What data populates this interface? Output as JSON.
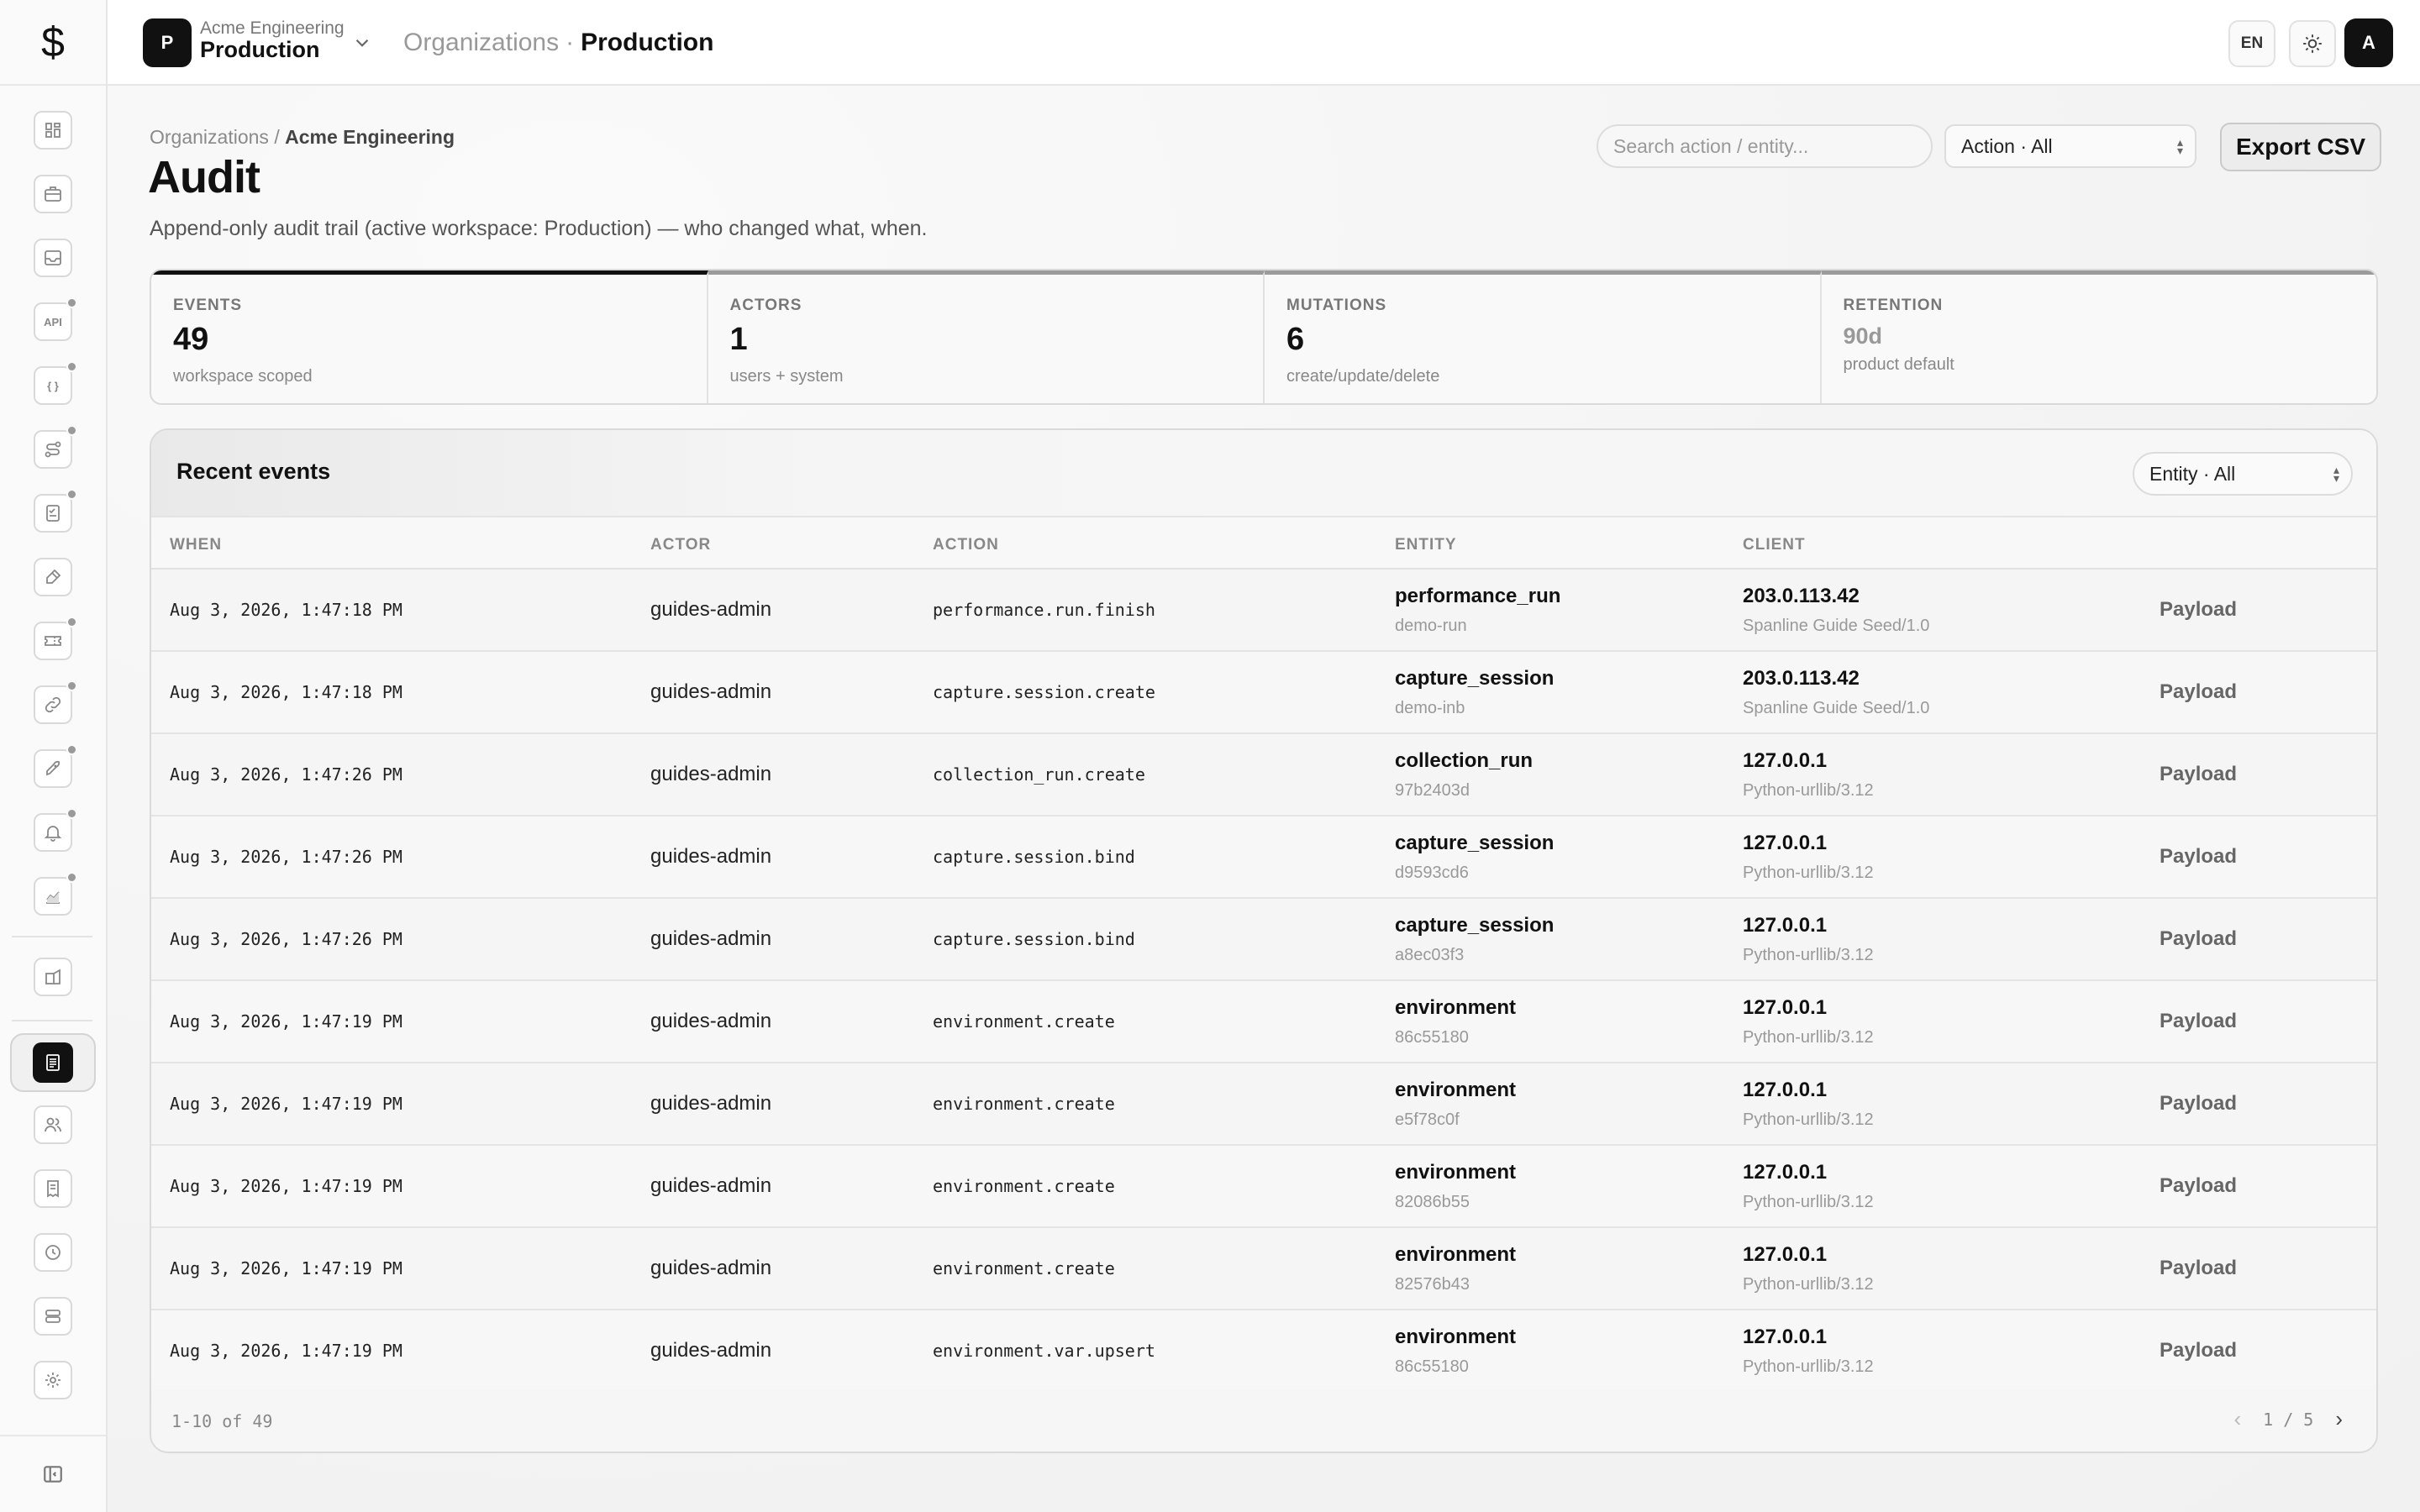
{
  "app": {
    "logo_glyph": "$"
  },
  "topbar": {
    "workspace_badge": "P",
    "workspace_org": "Acme Engineering",
    "workspace_name": "Production",
    "breadcrumb_root": "Organizations",
    "breadcrumb_sep": "·",
    "breadcrumb_current": "Production",
    "lang": "EN",
    "avatar": "A"
  },
  "sidebar": {
    "items": [
      {
        "icon": "dashboard-icon",
        "dot": false
      },
      {
        "icon": "briefcase-icon",
        "dot": false
      },
      {
        "icon": "inbox-icon",
        "dot": false
      },
      {
        "icon": "api-icon",
        "dot": true,
        "text": "API"
      },
      {
        "icon": "braces-icon",
        "dot": true,
        "text": "{ }"
      },
      {
        "icon": "route-icon",
        "dot": true
      },
      {
        "icon": "checklist-icon",
        "dot": true
      },
      {
        "icon": "brush-icon",
        "dot": false
      },
      {
        "icon": "ticket-icon",
        "dot": true
      },
      {
        "icon": "link-icon",
        "dot": true
      },
      {
        "icon": "rocket-icon",
        "dot": true
      },
      {
        "icon": "bell-icon",
        "dot": true
      },
      {
        "icon": "chart-icon",
        "dot": true
      },
      {
        "icon": "building-icon",
        "dot": false
      },
      {
        "icon": "audit-icon",
        "active": true
      },
      {
        "icon": "users-icon",
        "dot": false
      },
      {
        "icon": "receipt-icon",
        "dot": false
      },
      {
        "icon": "history-icon",
        "dot": false
      },
      {
        "icon": "storage-icon",
        "dot": false
      },
      {
        "icon": "gear-icon",
        "dot": false
      }
    ],
    "collapse_icon": "sidebar-collapse-icon"
  },
  "page": {
    "breadcrumb_root": "Organizations",
    "breadcrumb_sep": "/",
    "breadcrumb_current": "Acme Engineering",
    "title": "Audit",
    "subtitle": "Append-only audit trail (active workspace: Production) — who changed what, when."
  },
  "toolbar": {
    "search_placeholder": "Search action / entity...",
    "search_value": "",
    "action_filter": "Action · All",
    "export_label": "Export CSV"
  },
  "stats": [
    {
      "label": "EVENTS",
      "value": "49",
      "note": "workspace scoped"
    },
    {
      "label": "ACTORS",
      "value": "1",
      "note": "users + system"
    },
    {
      "label": "MUTATIONS",
      "value": "6",
      "note": "create/update/delete"
    },
    {
      "label": "RETENTION",
      "value": "90d",
      "note": "product default"
    }
  ],
  "events": {
    "title": "Recent events",
    "entity_filter": "Entity · All",
    "columns": [
      "WHEN",
      "ACTOR",
      "ACTION",
      "ENTITY",
      "CLIENT"
    ],
    "payload_label": "Payload",
    "rows": [
      {
        "when": "Aug 3, 2026, 1:47:18 PM",
        "actor": "guides-admin",
        "action": "performance.run.finish",
        "entity": "performance_run",
        "entity_id": "demo-run",
        "ip": "203.0.113.42",
        "ua": "Spanline Guide Seed/1.0"
      },
      {
        "when": "Aug 3, 2026, 1:47:18 PM",
        "actor": "guides-admin",
        "action": "capture.session.create",
        "entity": "capture_session",
        "entity_id": "demo-inb",
        "ip": "203.0.113.42",
        "ua": "Spanline Guide Seed/1.0"
      },
      {
        "when": "Aug 3, 2026, 1:47:26 PM",
        "actor": "guides-admin",
        "action": "collection_run.create",
        "entity": "collection_run",
        "entity_id": "97b2403d",
        "ip": "127.0.0.1",
        "ua": "Python-urllib/3.12"
      },
      {
        "when": "Aug 3, 2026, 1:47:26 PM",
        "actor": "guides-admin",
        "action": "capture.session.bind",
        "entity": "capture_session",
        "entity_id": "d9593cd6",
        "ip": "127.0.0.1",
        "ua": "Python-urllib/3.12"
      },
      {
        "when": "Aug 3, 2026, 1:47:26 PM",
        "actor": "guides-admin",
        "action": "capture.session.bind",
        "entity": "capture_session",
        "entity_id": "a8ec03f3",
        "ip": "127.0.0.1",
        "ua": "Python-urllib/3.12"
      },
      {
        "when": "Aug 3, 2026, 1:47:19 PM",
        "actor": "guides-admin",
        "action": "environment.create",
        "entity": "environment",
        "entity_id": "86c55180",
        "ip": "127.0.0.1",
        "ua": "Python-urllib/3.12"
      },
      {
        "when": "Aug 3, 2026, 1:47:19 PM",
        "actor": "guides-admin",
        "action": "environment.create",
        "entity": "environment",
        "entity_id": "e5f78c0f",
        "ip": "127.0.0.1",
        "ua": "Python-urllib/3.12"
      },
      {
        "when": "Aug 3, 2026, 1:47:19 PM",
        "actor": "guides-admin",
        "action": "environment.create",
        "entity": "environment",
        "entity_id": "82086b55",
        "ip": "127.0.0.1",
        "ua": "Python-urllib/3.12"
      },
      {
        "when": "Aug 3, 2026, 1:47:19 PM",
        "actor": "guides-admin",
        "action": "environment.create",
        "entity": "environment",
        "entity_id": "82576b43",
        "ip": "127.0.0.1",
        "ua": "Python-urllib/3.12"
      },
      {
        "when": "Aug 3, 2026, 1:47:19 PM",
        "actor": "guides-admin",
        "action": "environment.var.upsert",
        "entity": "environment",
        "entity_id": "86c55180",
        "ip": "127.0.0.1",
        "ua": "Python-urllib/3.12"
      }
    ],
    "footer_count": "1-10 of 49",
    "page_indicator": "1 / 5"
  }
}
